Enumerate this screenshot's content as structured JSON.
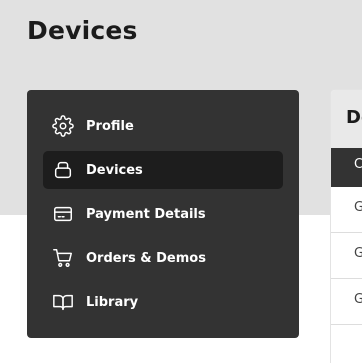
{
  "page": {
    "title": "Devices"
  },
  "sidebar": {
    "items": [
      {
        "label": "Profile",
        "icon": "gear-icon",
        "active": false
      },
      {
        "label": "Devices",
        "icon": "device-icon",
        "active": true
      },
      {
        "label": "Payment Details",
        "icon": "credit-card-icon",
        "active": false
      },
      {
        "label": "Orders & Demos",
        "icon": "cart-icon",
        "active": false
      },
      {
        "label": "Library",
        "icon": "book-icon",
        "active": false
      }
    ]
  },
  "right_panel": {
    "header": "De",
    "dark_row": "C",
    "items": [
      "G",
      "G",
      "G"
    ]
  }
}
